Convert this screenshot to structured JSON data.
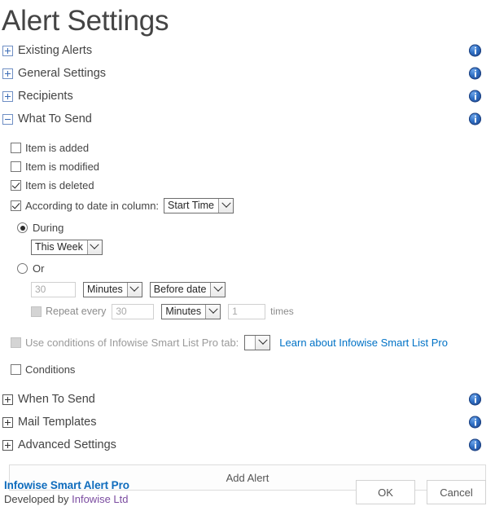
{
  "page": {
    "title": "Alert Settings"
  },
  "sections_top": [
    {
      "label": "Existing Alerts",
      "state": "collapsed",
      "icon": "plus-box-icon",
      "info": "info-icon"
    },
    {
      "label": "General Settings",
      "state": "collapsed",
      "icon": "plus-box-icon",
      "info": "info-icon"
    },
    {
      "label": "Recipients",
      "state": "collapsed",
      "icon": "plus-box-icon",
      "info": "info-icon"
    },
    {
      "label": "What To Send",
      "state": "expanded",
      "icon": "minus-box-icon",
      "info": "info-icon"
    }
  ],
  "what_to_send": {
    "checkboxes": [
      {
        "label": "Item is added",
        "checked": false,
        "disabled": false
      },
      {
        "label": "Item is modified",
        "checked": false,
        "disabled": false
      },
      {
        "label": "Item is deleted",
        "checked": true,
        "disabled": false
      }
    ],
    "according_to_date": {
      "label": "According to date in column:",
      "checked": true,
      "column_select": {
        "value": "Start Time"
      }
    },
    "during": {
      "radio_label": "During",
      "selected": true,
      "period_select": {
        "value": "This Week"
      }
    },
    "or": {
      "radio_label": "Or",
      "selected": false,
      "offset_value": "30",
      "unit_select": {
        "value": "Minutes"
      },
      "relation_select": {
        "value": "Before date"
      },
      "repeat": {
        "label": "Repeat every",
        "checked": false,
        "disabled": true,
        "interval_value": "30",
        "interval_unit_select": {
          "value": "Minutes"
        },
        "times_value": "1",
        "times_label": "times"
      }
    },
    "smart_list": {
      "label": "Use conditions of Infowise Smart List Pro tab:",
      "checked": false,
      "disabled": true,
      "tab_select": {
        "value": ""
      },
      "link_label": "Learn about Infowise Smart List Pro"
    },
    "conditions": {
      "label": "Conditions",
      "checked": false
    }
  },
  "sections_bottom": [
    {
      "label": "When To Send",
      "state": "collapsed",
      "icon": "plus-box-icon",
      "info": "info-icon"
    },
    {
      "label": "Mail Templates",
      "state": "collapsed",
      "icon": "plus-box-icon",
      "info": "info-icon"
    },
    {
      "label": "Advanced Settings",
      "state": "collapsed",
      "icon": "plus-box-icon",
      "info": "info-icon"
    }
  ],
  "add_alert": {
    "label": "Add Alert"
  },
  "footer": {
    "product_name": "Infowise Smart Alert Pro",
    "developed_by_prefix": "Developed by ",
    "developer_link": "Infowise Ltd",
    "ok_label": "OK",
    "cancel_label": "Cancel"
  },
  "colors": {
    "link": "#0072c6",
    "brand": "#0f6cbd",
    "visited_link": "#7b4ca0",
    "info_icon": "#2f6fc4",
    "text": "#444444",
    "disabled_text": "#9a9a9a"
  }
}
